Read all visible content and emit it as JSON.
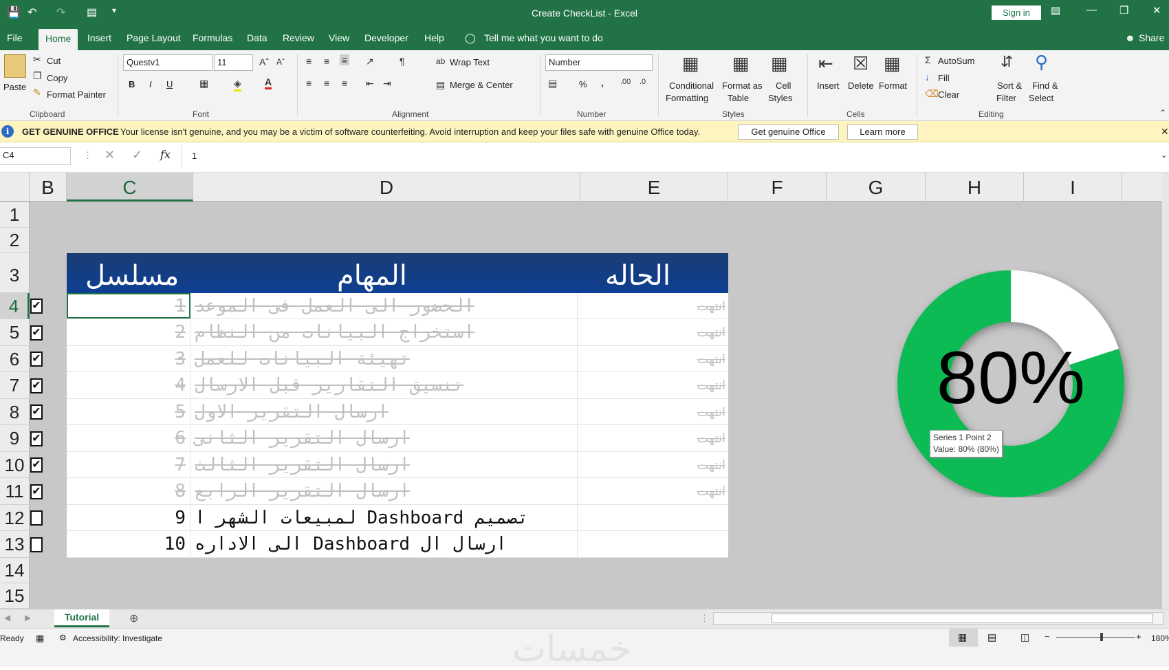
{
  "app": {
    "title": "Create CheckList  -  Excel",
    "sign_in": "Sign in",
    "share": "Share"
  },
  "menu_tabs": [
    "File",
    "Home",
    "Insert",
    "Page Layout",
    "Formulas",
    "Data",
    "Review",
    "View",
    "Developer",
    "Help"
  ],
  "tell_me": "Tell me what you want to do",
  "ribbon": {
    "clipboard": {
      "paste": "Paste",
      "cut": "Cut",
      "copy": "Copy",
      "format_painter": "Format Painter",
      "label": "Clipboard"
    },
    "font": {
      "name": "Questv1",
      "size": "11",
      "bold": "B",
      "italic": "I",
      "underline": "U",
      "label": "Font"
    },
    "alignment": {
      "wrap_text": "Wrap Text",
      "merge_center": "Merge & Center",
      "label": "Alignment"
    },
    "number": {
      "format": "Number",
      "percent": "%",
      "comma": ",",
      "label": "Number"
    },
    "styles": {
      "conditional": "Conditional",
      "conditional2": "Formatting",
      "format_as": "Format as",
      "table": "Table",
      "cell": "Cell",
      "styles_word": "Styles",
      "label": "Styles"
    },
    "cells": {
      "insert": "Insert",
      "delete": "Delete",
      "format": "Format",
      "label": "Cells"
    },
    "editing": {
      "autosum": "AutoSum",
      "fill": "Fill",
      "clear": "Clear",
      "sort": "Sort &",
      "filter": "Filter",
      "find": "Find &",
      "select": "Select",
      "label": "Editing"
    }
  },
  "message_bar": {
    "title": "GET GENUINE OFFICE",
    "text": "Your license isn't genuine, and you may be a victim of software counterfeiting. Avoid interruption and keep your files safe with genuine Office today.",
    "btn_genuine": "Get genuine Office",
    "btn_learn": "Learn more"
  },
  "formula_bar": {
    "name_box": "C4",
    "fx": "fx",
    "value": "1"
  },
  "columns": [
    "B",
    "C",
    "D",
    "E",
    "F",
    "G",
    "H",
    "I"
  ],
  "rows": [
    "1",
    "2",
    "3",
    "4",
    "5",
    "6",
    "7",
    "8",
    "9",
    "10",
    "11",
    "12",
    "13",
    "14",
    "15"
  ],
  "table": {
    "headers": {
      "serial": "مسلسل",
      "tasks": "المهام",
      "status": "الحاله"
    },
    "rows": [
      {
        "num": "1",
        "task": "الحضور الى العمل فى الموعد",
        "status": "انتهت",
        "done": true
      },
      {
        "num": "2",
        "task": "استخراج البيانات من النظام",
        "status": "انتهت",
        "done": true
      },
      {
        "num": "3",
        "task": "تهيئة البيانات للعمل",
        "status": "انتهت",
        "done": true
      },
      {
        "num": "4",
        "task": "تنسيق التقارير قبل الارسال",
        "status": "انتهت",
        "done": true
      },
      {
        "num": "5",
        "task": "ارسال التقرير الاول",
        "status": "انتهت",
        "done": true
      },
      {
        "num": "6",
        "task": "ارسال التقرير الثانى",
        "status": "انتهت",
        "done": true
      },
      {
        "num": "7",
        "task": "ارسال التقرير الثالث",
        "status": "انتهت",
        "done": true
      },
      {
        "num": "8",
        "task": "ارسال التقرير الرابع",
        "status": "انتهت",
        "done": true
      },
      {
        "num": "9",
        "task": "تصميم Dashboard لمبيعات الشهر ا",
        "status": "",
        "done": false
      },
      {
        "num": "10",
        "task": "ارسال ال Dashboard الى الاداره",
        "status": "",
        "done": false
      }
    ]
  },
  "chart_data": {
    "type": "pie",
    "variant": "doughnut",
    "label": "80%",
    "values": [
      80,
      20
    ],
    "colors": [
      "#11bb55",
      "#ffffff"
    ],
    "tooltip_line1": "Series 1 Point 2",
    "tooltip_line2": "Value: 80% (80%)"
  },
  "sheet_tab": "Tutorial",
  "status": {
    "ready": "Ready",
    "accessibility": "Accessibility: Investigate",
    "zoom": "180%"
  },
  "watermark": "خمسات"
}
